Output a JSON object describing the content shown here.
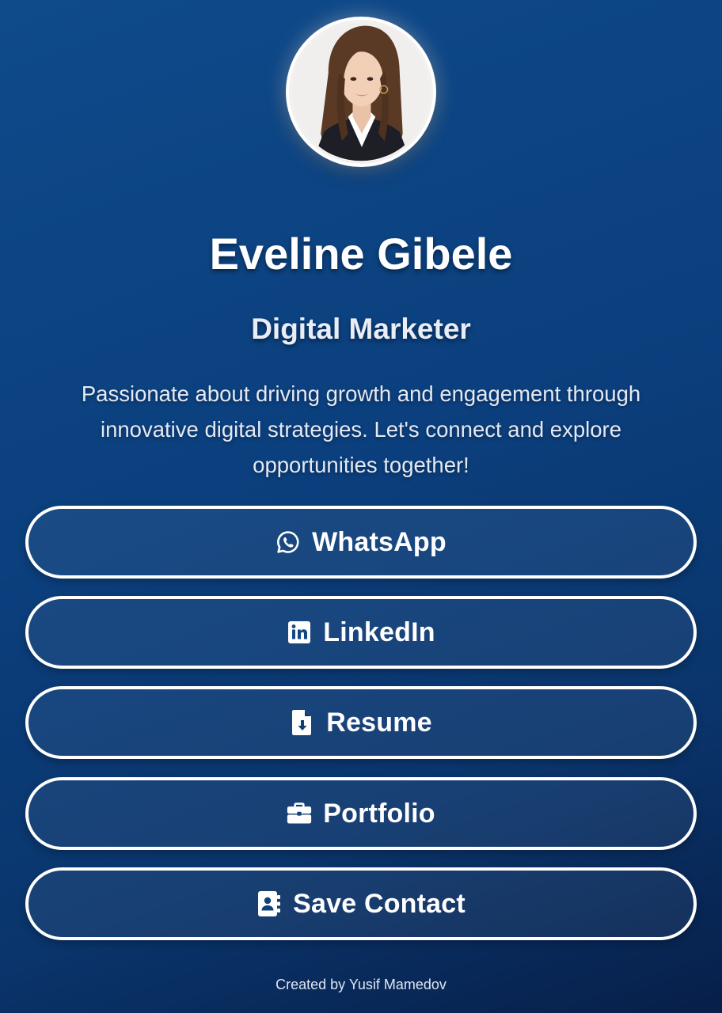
{
  "profile": {
    "name": "Eveline Gibele",
    "role": "Digital Marketer",
    "bio": "Passionate about driving growth and engagement through innovative digital strategies. Let's connect and explore opportunities together!"
  },
  "buttons": {
    "whatsapp": {
      "label": "WhatsApp",
      "icon": "whatsapp-icon"
    },
    "linkedin": {
      "label": "LinkedIn",
      "icon": "linkedin-icon"
    },
    "resume": {
      "label": "Resume",
      "icon": "file-download-icon"
    },
    "portfolio": {
      "label": "Portfolio",
      "icon": "briefcase-icon"
    },
    "save_contact": {
      "label": "Save Contact",
      "icon": "address-book-icon"
    }
  },
  "footer": {
    "text": "Created by Yusif Mamedov"
  },
  "colors": {
    "background_top": "#0f4a8a",
    "background_bottom": "#071f49",
    "button_border": "#ffffff",
    "text": "#ffffff"
  }
}
